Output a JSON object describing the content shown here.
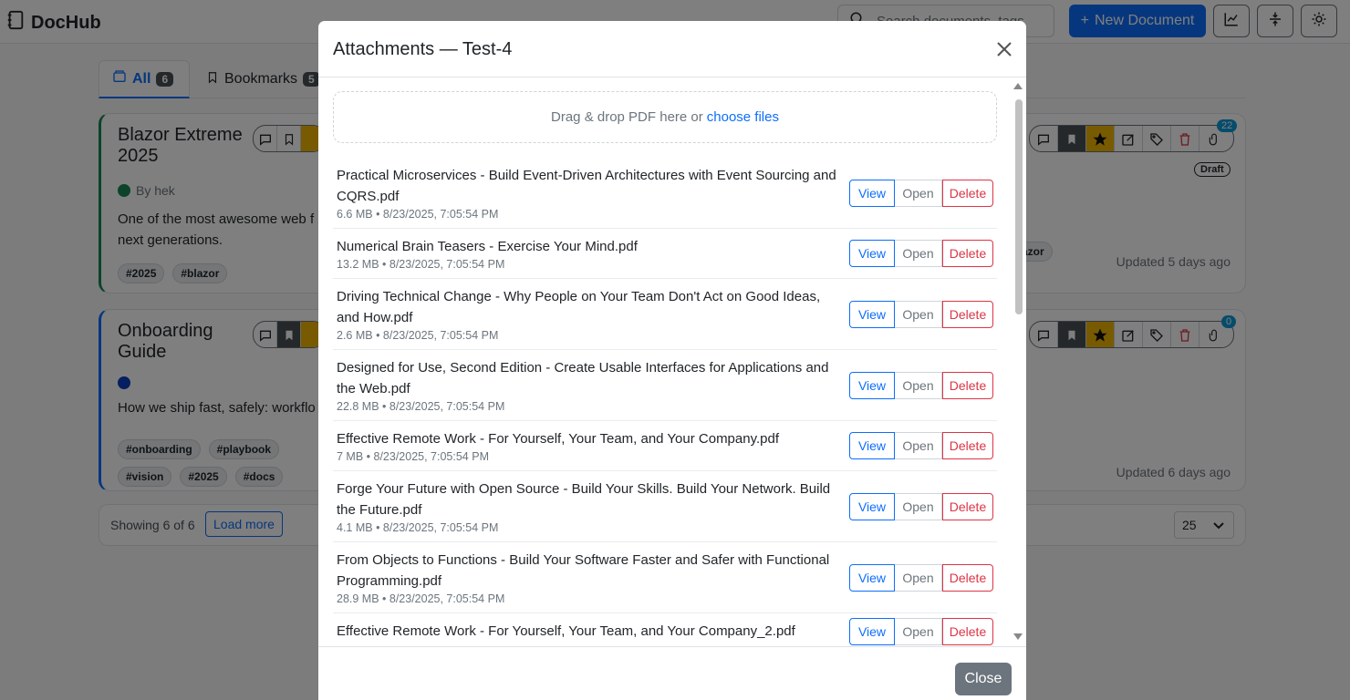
{
  "app": {
    "title": "DocHub"
  },
  "header": {
    "search_placeholder": "Search documents, tags",
    "new_document_label": "New Document"
  },
  "tabs": [
    {
      "label": "All",
      "count": "6"
    },
    {
      "label": "Bookmarks",
      "count": "5"
    }
  ],
  "cards": [
    {
      "title": "Blazor Extreme 2025",
      "author": "By hek",
      "description": "One of the most awesome web f next generations.",
      "tags": [
        "#2025",
        "#blazor"
      ],
      "updated": "Updated 5 days ago",
      "attachment_count": "22",
      "status": "Draft",
      "right_tag_fragment": "azor"
    },
    {
      "title": "Onboarding Guide",
      "author": "",
      "description": "How we ship fast, safely: workflo",
      "tags": [
        "#onboarding",
        "#playbook",
        "#vision",
        "#2025",
        "#docs"
      ],
      "updated": "Updated 6 days ago",
      "attachment_count": "0"
    }
  ],
  "footer": {
    "showing": "Showing 6 of 6",
    "load_more": "Load more",
    "page_size": "25"
  },
  "modal": {
    "title": "Attachments — Test-4",
    "dropzone_text": "Drag & drop PDF here or",
    "dropzone_link": "choose files",
    "view_label": "View",
    "open_label": "Open",
    "delete_label": "Delete",
    "close_label": "Close",
    "files": [
      {
        "name": "Practical Microservices - Build Event-Driven Architectures with Event Sourcing and CQRS.pdf",
        "meta": "6.6 MB • 8/23/2025, 7:05:54 PM"
      },
      {
        "name": "Numerical Brain Teasers - Exercise Your Mind.pdf",
        "meta": "13.2 MB • 8/23/2025, 7:05:54 PM"
      },
      {
        "name": "Driving Technical Change - Why People on Your Team Don't Act on Good Ideas, and How.pdf",
        "meta": "2.6 MB • 8/23/2025, 7:05:54 PM"
      },
      {
        "name": "Designed for Use, Second Edition - Create Usable Interfaces for Applications and the Web.pdf",
        "meta": "22.8 MB • 8/23/2025, 7:05:54 PM"
      },
      {
        "name": "Effective Remote Work - For Yourself, Your Team, and Your Company.pdf",
        "meta": "7 MB • 8/23/2025, 7:05:54 PM"
      },
      {
        "name": "Forge Your Future with Open Source - Build Your Skills. Build Your Network. Build the Future.pdf",
        "meta": "4.1 MB • 8/23/2025, 7:05:54 PM"
      },
      {
        "name": "From Objects to Functions - Build Your Software Faster and Safer with Functional Programming.pdf",
        "meta": "28.9 MB • 8/23/2025, 7:05:54 PM"
      },
      {
        "name": "Effective Remote Work - For Yourself, Your Team, and Your Company_2.pdf",
        "meta": ""
      }
    ]
  },
  "colors": {
    "primary": "#0d6efd",
    "danger": "#dc3545",
    "success": "#198754",
    "star": "#f0b400"
  }
}
